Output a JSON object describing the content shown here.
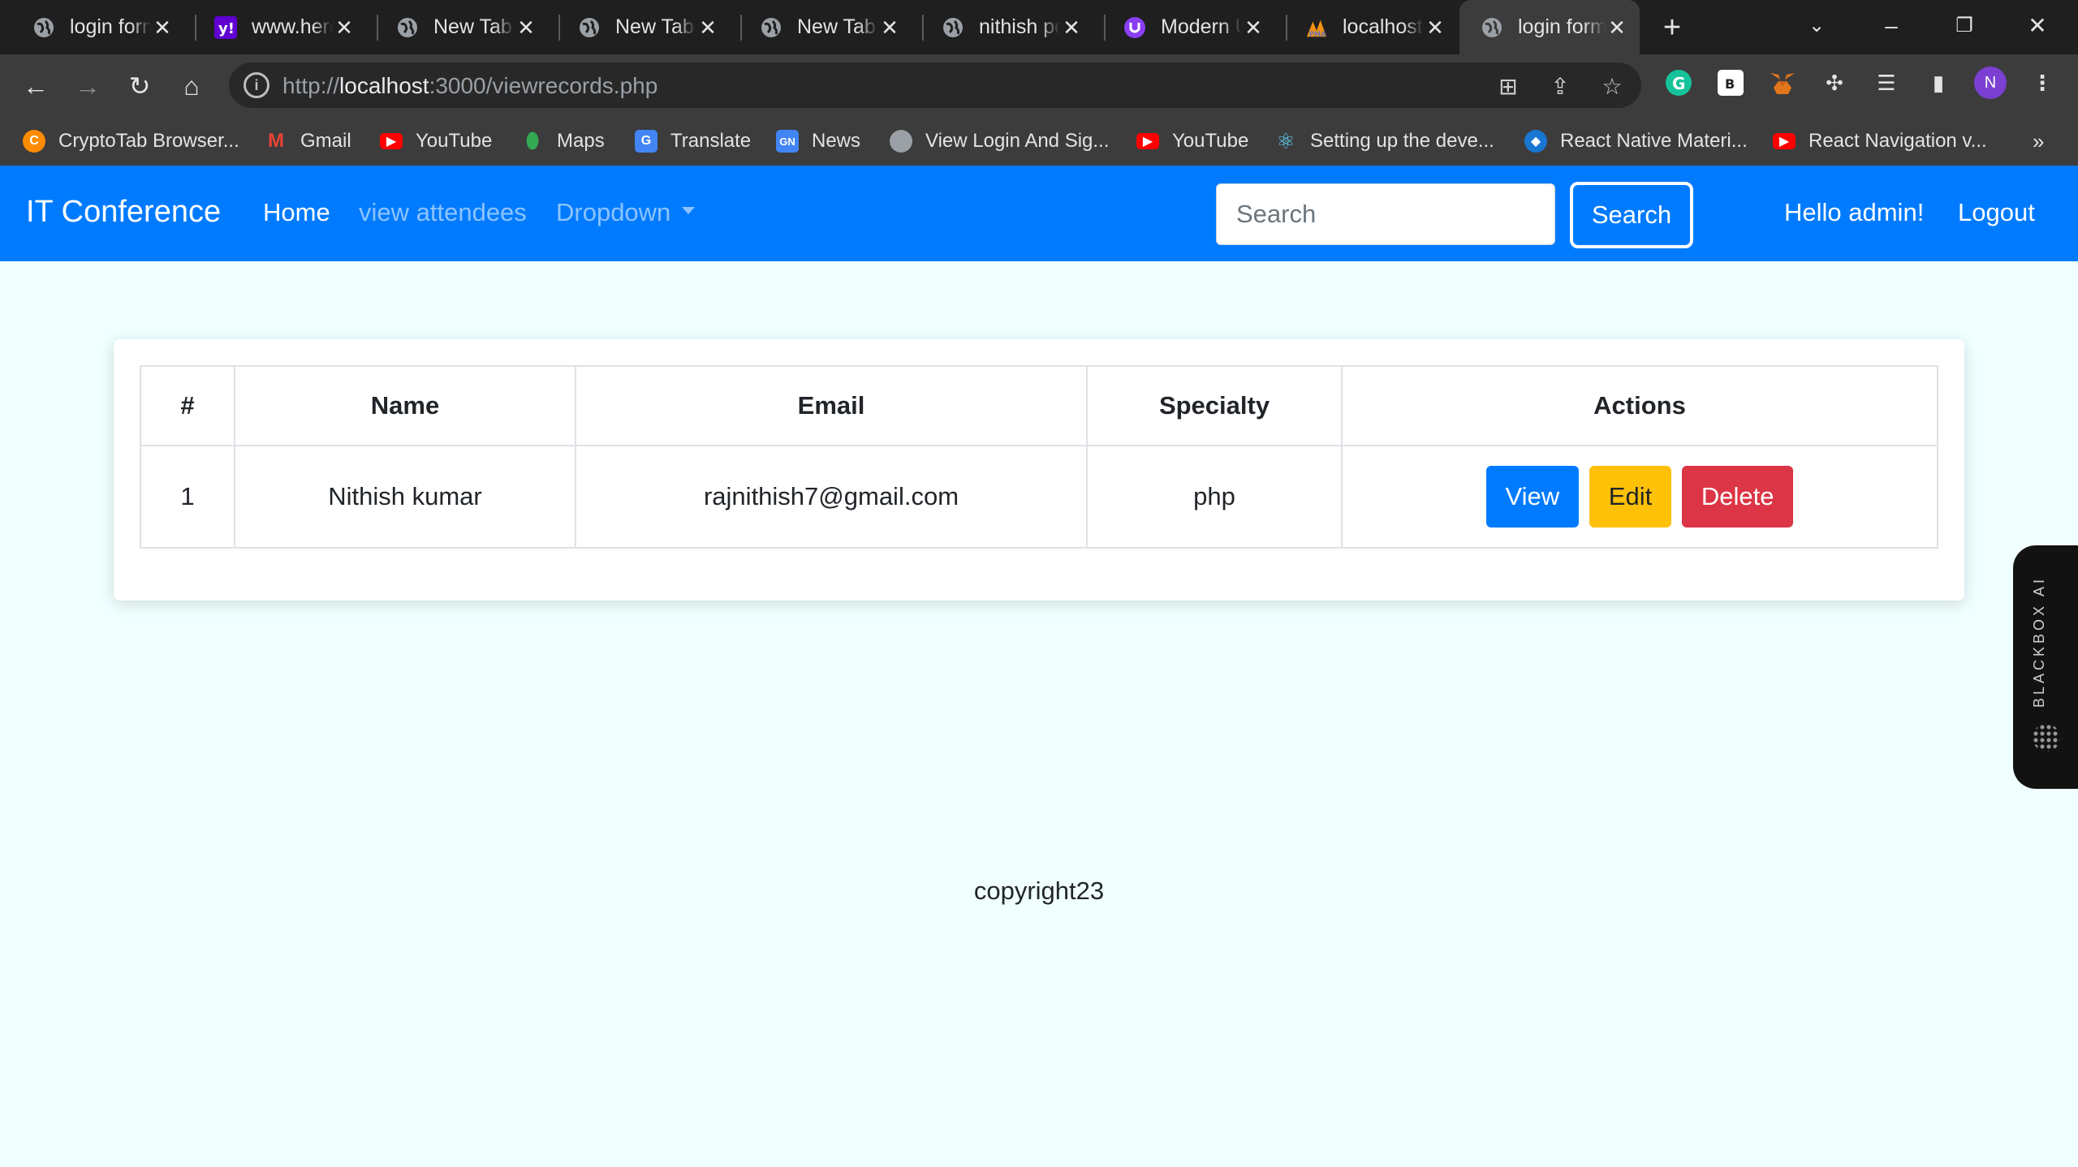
{
  "browser": {
    "tabs": [
      {
        "title": "login form",
        "icon": "globe-icon",
        "active": false
      },
      {
        "title": "www.herokuapp",
        "icon": "yahoo-icon",
        "active": false
      },
      {
        "title": "New Tab",
        "icon": "globe-icon",
        "active": false
      },
      {
        "title": "New Tab",
        "icon": "globe-icon",
        "active": false
      },
      {
        "title": "New Tab",
        "icon": "globe-icon",
        "active": false
      },
      {
        "title": "nithish portfolio",
        "icon": "globe-icon",
        "active": false
      },
      {
        "title": "Modern UI",
        "icon": "uplabs-icon",
        "active": false
      },
      {
        "title": "localhost",
        "icon": "phpmyadmin-icon",
        "active": false
      },
      {
        "title": "login form",
        "icon": "globe-icon",
        "active": true
      }
    ],
    "url_host": "localhost",
    "url_prefix": "http://",
    "url_rest": ":3000/viewrecords.php",
    "profile_initial": "N",
    "bookmarks": [
      {
        "label": "CryptoTab Browser...",
        "icon": "cryptotab-icon"
      },
      {
        "label": "Gmail",
        "icon": "gmail-icon"
      },
      {
        "label": "YouTube",
        "icon": "youtube-icon"
      },
      {
        "label": "Maps",
        "icon": "maps-icon"
      },
      {
        "label": "Translate",
        "icon": "translate-icon"
      },
      {
        "label": "News",
        "icon": "news-icon"
      },
      {
        "label": "View Login And Sig...",
        "icon": "globe-icon"
      },
      {
        "label": "YouTube",
        "icon": "youtube-icon"
      },
      {
        "label": "Setting up the deve...",
        "icon": "react-icon"
      },
      {
        "label": "React Native Materi...",
        "icon": "react-native-paper-icon"
      },
      {
        "label": "React Navigation v...",
        "icon": "youtube-icon"
      }
    ]
  },
  "navbar": {
    "brand": "IT Conference",
    "links": [
      "Home",
      "view attendees",
      "Dropdown"
    ],
    "search_placeholder": "Search",
    "search_button": "Search",
    "greeting": "Hello admin!",
    "logout": "Logout",
    "color": "#007bff"
  },
  "table": {
    "headers": [
      "#",
      "Name",
      "Email",
      "Specialty",
      "Actions"
    ],
    "rows": [
      {
        "num": "1",
        "name": "Nithish kumar",
        "email": "rajnithish7@gmail.com",
        "specialty": "php"
      }
    ],
    "actions": {
      "view": "View",
      "edit": "Edit",
      "delete": "Delete"
    }
  },
  "footer": {
    "text": "copyright23"
  },
  "sidebar_widget": {
    "label": "BLACKBOX AI"
  }
}
